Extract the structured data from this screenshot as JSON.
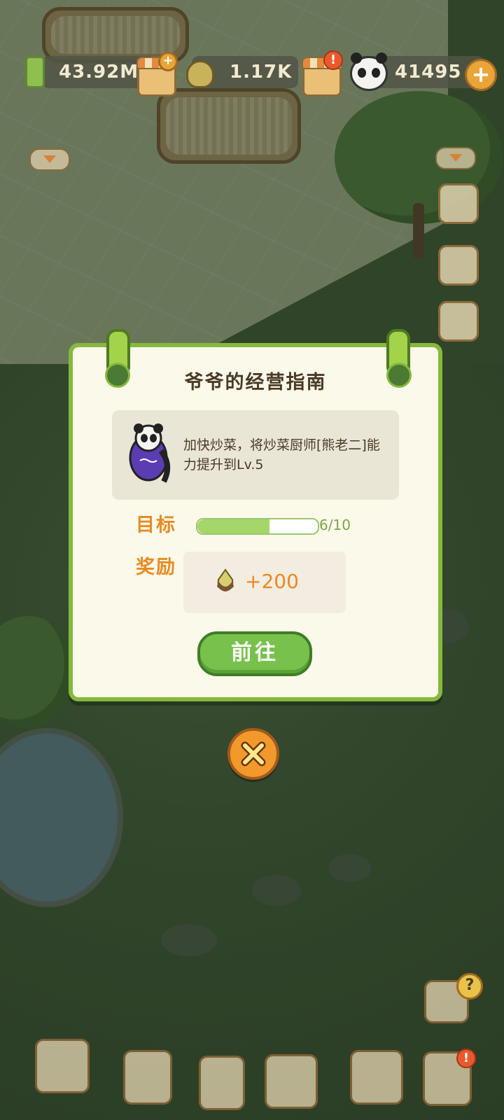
{
  "hud": {
    "bamboo_amount": "43.92M",
    "shoot_amount": "1.17K",
    "panda_amount": "41495",
    "shop_alert": "!",
    "plus_label": "+"
  },
  "dialog": {
    "title": "爷爷的经营指南",
    "task_text": "加快炒菜，将炒菜厨师[熊老二]能力提升到Lv.5",
    "target_label": "目标",
    "progress_current": 6,
    "progress_total": 10,
    "progress_text": "6/10",
    "reward_label": "奖励",
    "reward_amount": "+200",
    "go_button_label": "前往"
  },
  "bottom_bar": {
    "alert": "!",
    "help": "?"
  },
  "colors": {
    "accent_green": "#86b83e",
    "accent_orange": "#e98a22",
    "panel_bg": "#fbf9ea"
  },
  "icons": {
    "close": "close-icon",
    "bamboo": "bamboo-icon",
    "shoot": "bamboo-shoot-icon",
    "panda": "panda-icon",
    "shop": "shop-icon"
  }
}
